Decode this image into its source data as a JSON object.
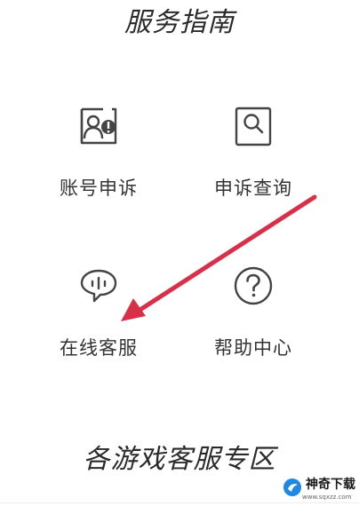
{
  "sections": {
    "service_guide_title": "服务指南",
    "game_zone_title": "各游戏客服专区"
  },
  "tiles": [
    {
      "label": "账号申诉",
      "icon": "account-appeal-icon"
    },
    {
      "label": "申诉查询",
      "icon": "appeal-search-icon"
    },
    {
      "label": "在线客服",
      "icon": "chat-bubble-icon"
    },
    {
      "label": "帮助中心",
      "icon": "question-circle-icon"
    }
  ],
  "annotation": {
    "arrow_color": "#d9304a"
  },
  "watermark": {
    "brand": "神奇下载",
    "url": "www.sqxzz.com"
  },
  "colors": {
    "icon_stroke": "#444444",
    "text": "#333333",
    "background": "#ffffff"
  }
}
